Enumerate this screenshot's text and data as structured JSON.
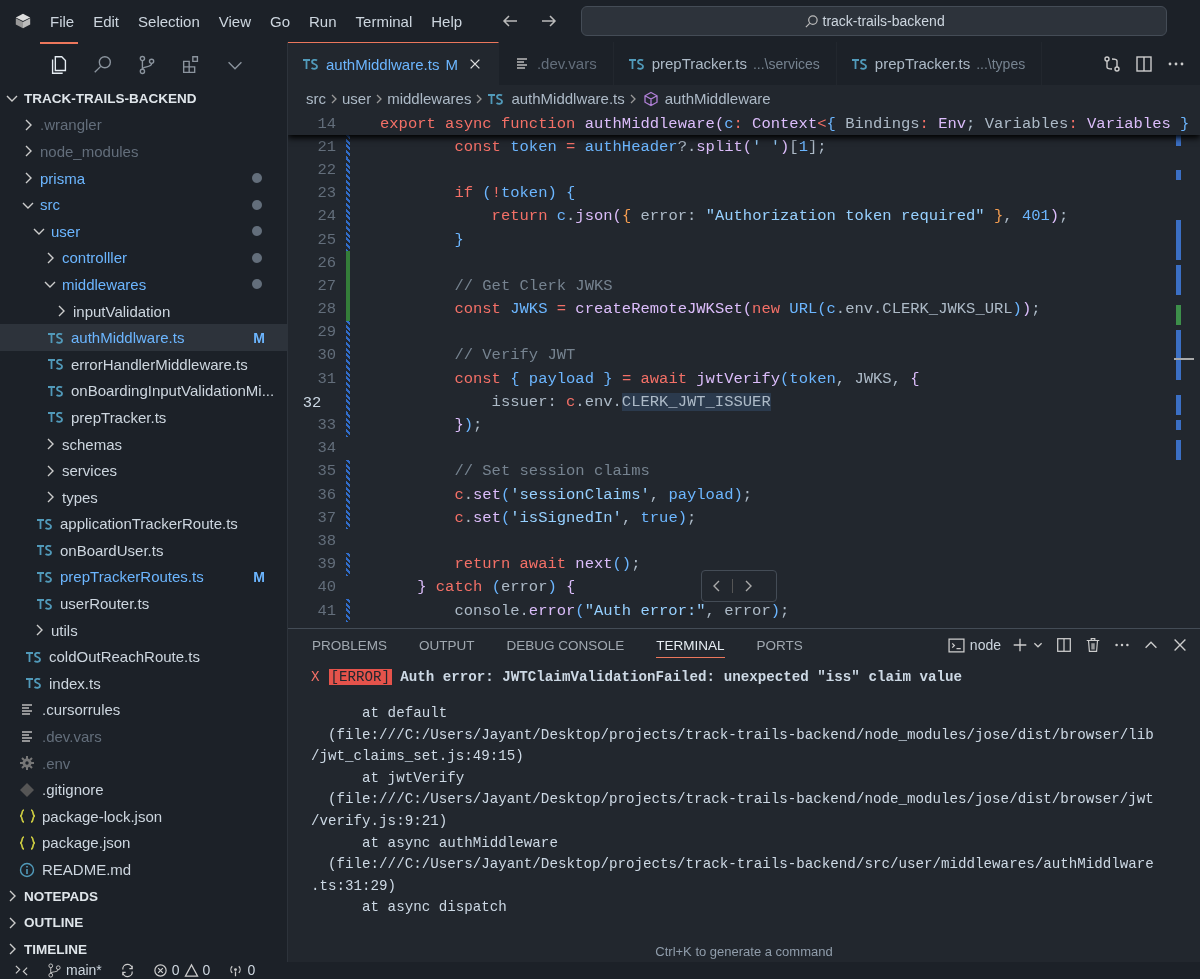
{
  "menu": [
    "File",
    "Edit",
    "Selection",
    "View",
    "Go",
    "Run",
    "Terminal",
    "Help"
  ],
  "command_center": {
    "value": "track-trails-backend"
  },
  "activity_bar": [
    {
      "kind": "files",
      "selected": true
    },
    {
      "kind": "search",
      "selected": false
    },
    {
      "kind": "source-control",
      "selected": false
    },
    {
      "kind": "extensions",
      "selected": false
    },
    {
      "kind": "more",
      "selected": false
    }
  ],
  "explorer": {
    "title": "TRACK-TRAILS-BACKEND",
    "expanded": true,
    "tree": [
      {
        "label": ".wrangler",
        "kind": "folder",
        "expanded": false,
        "modified": false,
        "ignored": true,
        "selected": false
      },
      {
        "label": "node_modules",
        "kind": "folder",
        "expanded": false,
        "modified": false,
        "ignored": true,
        "selected": false
      },
      {
        "label": "prisma",
        "kind": "folder",
        "expanded": false,
        "modified": true,
        "ignored": false,
        "selected": false
      },
      {
        "label": "src",
        "kind": "folder",
        "expanded": true,
        "modified": true,
        "ignored": false,
        "selected": false,
        "children": [
          {
            "label": "user",
            "kind": "folder",
            "expanded": true,
            "modified": true,
            "ignored": false,
            "selected": false,
            "children": [
              {
                "label": "controlller",
                "kind": "folder",
                "expanded": false,
                "modified": true,
                "ignored": false,
                "selected": false
              },
              {
                "label": "middlewares",
                "kind": "folder",
                "expanded": true,
                "modified": true,
                "ignored": false,
                "selected": false,
                "children": [
                  {
                    "label": "inputValidation",
                    "kind": "folder",
                    "expanded": false,
                    "modified": false,
                    "ignored": false,
                    "selected": false
                  },
                  {
                    "label": "authMiddlware.ts",
                    "kind": "ts",
                    "modified": true,
                    "ignored": false,
                    "badge": "M",
                    "selected": true
                  },
                  {
                    "label": "errorHandlerMiddleware.ts",
                    "kind": "ts",
                    "modified": false,
                    "ignored": false,
                    "selected": false
                  },
                  {
                    "label": "onBoardingInputValidationMi...",
                    "kind": "ts",
                    "modified": false,
                    "ignored": false,
                    "selected": false
                  },
                  {
                    "label": "prepTracker.ts",
                    "kind": "ts",
                    "modified": false,
                    "ignored": false,
                    "selected": false
                  }
                ]
              },
              {
                "label": "schemas",
                "kind": "folder",
                "expanded": false,
                "modified": false,
                "ignored": false,
                "selected": false
              },
              {
                "label": "services",
                "kind": "folder",
                "expanded": false,
                "modified": false,
                "ignored": false,
                "selected": false
              },
              {
                "label": "types",
                "kind": "folder",
                "expanded": false,
                "modified": false,
                "ignored": false,
                "selected": false
              },
              {
                "label": "applicationTrackerRoute.ts",
                "kind": "ts",
                "modified": false,
                "ignored": false,
                "selected": false
              },
              {
                "label": "onBoardUser.ts",
                "kind": "ts",
                "modified": false,
                "ignored": false,
                "selected": false
              },
              {
                "label": "prepTrackerRoutes.ts",
                "kind": "ts",
                "modified": true,
                "ignored": false,
                "badge": "M",
                "selected": false
              },
              {
                "label": "userRouter.ts",
                "kind": "ts",
                "modified": false,
                "ignored": false,
                "selected": false
              }
            ]
          },
          {
            "label": "utils",
            "kind": "folder",
            "expanded": false,
            "modified": false,
            "ignored": false,
            "selected": false
          },
          {
            "label": "coldOutReachRoute.ts",
            "kind": "ts",
            "modified": false,
            "ignored": false,
            "selected": false
          },
          {
            "label": "index.ts",
            "kind": "ts",
            "modified": false,
            "ignored": false,
            "selected": false
          }
        ]
      },
      {
        "label": ".cursorrules",
        "kind": "text",
        "modified": false,
        "ignored": false,
        "selected": false
      },
      {
        "label": ".dev.vars",
        "kind": "text",
        "modified": false,
        "ignored": true,
        "selected": false
      },
      {
        "label": ".env",
        "kind": "gear",
        "modified": false,
        "ignored": true,
        "selected": false
      },
      {
        "label": ".gitignore",
        "kind": "git",
        "modified": false,
        "ignored": false,
        "selected": false
      },
      {
        "label": "package-lock.json",
        "kind": "json",
        "modified": false,
        "ignored": false,
        "selected": false
      },
      {
        "label": "package.json",
        "kind": "json",
        "modified": false,
        "ignored": false,
        "selected": false
      },
      {
        "label": "README.md",
        "kind": "info",
        "modified": false,
        "ignored": false,
        "selected": false
      }
    ]
  },
  "sections": [
    {
      "title": "NOTEPADS",
      "expanded": false
    },
    {
      "title": "OUTLINE",
      "expanded": false
    },
    {
      "title": "TIMELINE",
      "expanded": false
    }
  ],
  "tabs": [
    {
      "kind": "ts",
      "label": "authMiddlware.ts",
      "badge": "M",
      "modified": true,
      "ignored": false,
      "selected": true
    },
    {
      "kind": "text",
      "label": ".dev.vars",
      "modified": false,
      "ignored": true,
      "selected": false
    },
    {
      "kind": "ts",
      "label": "prepTracker.ts",
      "description": "...\\services",
      "modified": false,
      "ignored": false,
      "selected": false
    },
    {
      "kind": "ts",
      "label": "prepTracker.ts",
      "description": "...\\types",
      "modified": false,
      "ignored": false,
      "selected": false
    }
  ],
  "breadcrumbs": [
    {
      "kind": "folder",
      "label": "src"
    },
    {
      "kind": "folder",
      "label": "user"
    },
    {
      "kind": "folder",
      "label": "middlewares"
    },
    {
      "kind": "ts",
      "label": "authMiddlware.ts"
    },
    {
      "kind": "symbol",
      "label": "authMiddleware"
    }
  ],
  "sticky_line": {
    "number": "14",
    "tokens": [
      {
        "kind": "keyword",
        "text": "export async function "
      },
      {
        "kind": "function",
        "text": "authMiddleware"
      },
      {
        "kind": "bracket",
        "text": "("
      },
      {
        "kind": "variable",
        "text": "c"
      },
      {
        "kind": "keyword",
        "text": ": "
      },
      {
        "kind": "function",
        "text": "Context"
      },
      {
        "kind": "keyword",
        "text": "<"
      },
      {
        "kind": "bracket2",
        "text": "{ "
      },
      {
        "kind": "plain",
        "text": "Bindings"
      },
      {
        "kind": "keyword",
        "text": ": "
      },
      {
        "kind": "function",
        "text": "Env"
      },
      {
        "kind": "plain",
        "text": "; Variables"
      },
      {
        "kind": "keyword",
        "text": ": "
      },
      {
        "kind": "function",
        "text": "Variables"
      },
      {
        "kind": "bracket2",
        "text": " }"
      }
    ]
  },
  "code_lines": [
    {
      "number": "21",
      "modified": true,
      "added": false,
      "active": false,
      "tokens": [
        {
          "kind": "keyword",
          "text": "        const "
        },
        {
          "kind": "variable",
          "text": "token"
        },
        {
          "kind": "keyword",
          "text": " = "
        },
        {
          "kind": "variable",
          "text": "authHeader"
        },
        {
          "kind": "plain",
          "text": "?."
        },
        {
          "kind": "function",
          "text": "split"
        },
        {
          "kind": "bracket",
          "text": "("
        },
        {
          "kind": "string",
          "text": "' '"
        },
        {
          "kind": "bracket",
          "text": ")"
        },
        {
          "kind": "plain",
          "text": "["
        },
        {
          "kind": "number",
          "text": "1"
        },
        {
          "kind": "plain",
          "text": "];"
        }
      ]
    },
    {
      "number": "22",
      "modified": true,
      "added": false,
      "active": false
    },
    {
      "number": "23",
      "modified": true,
      "added": false,
      "active": false,
      "tokens": [
        {
          "kind": "keyword",
          "text": "        if "
        },
        {
          "kind": "bracket2",
          "text": "("
        },
        {
          "kind": "keyword",
          "text": "!"
        },
        {
          "kind": "variable",
          "text": "token"
        },
        {
          "kind": "bracket2",
          "text": ") {"
        }
      ]
    },
    {
      "number": "24",
      "modified": true,
      "added": false,
      "active": false,
      "tokens": [
        {
          "kind": "keyword",
          "text": "            return "
        },
        {
          "kind": "variable",
          "text": "c"
        },
        {
          "kind": "plain",
          "text": "."
        },
        {
          "kind": "function",
          "text": "json"
        },
        {
          "kind": "bracket",
          "text": "("
        },
        {
          "kind": "bracket3",
          "text": "{ "
        },
        {
          "kind": "plain",
          "text": "error: "
        },
        {
          "kind": "string",
          "text": "\"Authorization token required\""
        },
        {
          "kind": "bracket3",
          "text": " }"
        },
        {
          "kind": "plain",
          "text": ", "
        },
        {
          "kind": "number",
          "text": "401"
        },
        {
          "kind": "bracket",
          "text": ")"
        },
        {
          "kind": "plain",
          "text": ";"
        }
      ]
    },
    {
      "number": "25",
      "modified": true,
      "added": false,
      "active": false,
      "tokens": [
        {
          "kind": "bracket2",
          "text": "        }"
        }
      ]
    },
    {
      "number": "26",
      "modified": false,
      "added": true,
      "active": false
    },
    {
      "number": "27",
      "modified": false,
      "added": true,
      "active": false,
      "tokens": [
        {
          "kind": "comment",
          "text": "        // Get Clerk JWKS"
        }
      ]
    },
    {
      "number": "28",
      "modified": false,
      "added": true,
      "active": false,
      "tokens": [
        {
          "kind": "keyword",
          "text": "        const "
        },
        {
          "kind": "variable",
          "text": "JWKS"
        },
        {
          "kind": "keyword",
          "text": " = "
        },
        {
          "kind": "function",
          "text": "createRemoteJWKSet"
        },
        {
          "kind": "bracket",
          "text": "("
        },
        {
          "kind": "keyword",
          "text": "new "
        },
        {
          "kind": "variable",
          "text": "URL"
        },
        {
          "kind": "bracket2",
          "text": "("
        },
        {
          "kind": "variable",
          "text": "c"
        },
        {
          "kind": "plain",
          "text": ".env.CLERK_JWKS_URL"
        },
        {
          "kind": "bracket2",
          "text": ")"
        },
        {
          "kind": "bracket",
          "text": ")"
        },
        {
          "kind": "plain",
          "text": ";"
        }
      ]
    },
    {
      "number": "29",
      "modified": true,
      "added": false,
      "active": false
    },
    {
      "number": "30",
      "modified": true,
      "added": false,
      "active": false,
      "tokens": [
        {
          "kind": "comment",
          "text": "        // Verify JWT"
        }
      ]
    },
    {
      "number": "31",
      "modified": true,
      "added": false,
      "active": false,
      "tokens": [
        {
          "kind": "keyword",
          "text": "        const "
        },
        {
          "kind": "bracket2",
          "text": "{ "
        },
        {
          "kind": "variable",
          "text": "payload"
        },
        {
          "kind": "bracket2",
          "text": " }"
        },
        {
          "kind": "keyword",
          "text": " = await "
        },
        {
          "kind": "function",
          "text": "jwtVerify"
        },
        {
          "kind": "bracket2",
          "text": "("
        },
        {
          "kind": "variable",
          "text": "token"
        },
        {
          "kind": "plain",
          "text": ", JWKS, "
        },
        {
          "kind": "bracket",
          "text": "{"
        }
      ]
    },
    {
      "number": "32",
      "modified": true,
      "added": false,
      "active": true,
      "tokens": [
        {
          "kind": "plain",
          "text": "            issuer: "
        },
        {
          "kind": "keyword",
          "text": "c"
        },
        {
          "kind": "plain",
          "text": ".env."
        },
        {
          "kind": "highlight",
          "text": "CLERK_JWT_ISSUER"
        }
      ]
    },
    {
      "number": "33",
      "modified": true,
      "added": false,
      "active": false,
      "tokens": [
        {
          "kind": "bracket",
          "text": "        }"
        },
        {
          "kind": "bracket2",
          "text": ")"
        },
        {
          "kind": "plain",
          "text": ";"
        }
      ]
    },
    {
      "number": "34",
      "modified": false,
      "added": false,
      "active": false
    },
    {
      "number": "35",
      "modified": true,
      "added": false,
      "active": false,
      "tokens": [
        {
          "kind": "comment",
          "text": "        // Set session claims"
        }
      ]
    },
    {
      "number": "36",
      "modified": true,
      "added": false,
      "active": false,
      "tokens": [
        {
          "kind": "keyword",
          "text": "        c"
        },
        {
          "kind": "plain",
          "text": "."
        },
        {
          "kind": "function",
          "text": "set"
        },
        {
          "kind": "bracket2",
          "text": "("
        },
        {
          "kind": "string",
          "text": "'sessionClaims'"
        },
        {
          "kind": "plain",
          "text": ", "
        },
        {
          "kind": "variable",
          "text": "payload"
        },
        {
          "kind": "bracket2",
          "text": ")"
        },
        {
          "kind": "plain",
          "text": ";"
        }
      ]
    },
    {
      "number": "37",
      "modified": true,
      "added": false,
      "active": false,
      "tokens": [
        {
          "kind": "keyword",
          "text": "        c"
        },
        {
          "kind": "plain",
          "text": "."
        },
        {
          "kind": "function",
          "text": "set"
        },
        {
          "kind": "bracket2",
          "text": "("
        },
        {
          "kind": "string",
          "text": "'isSignedIn'"
        },
        {
          "kind": "plain",
          "text": ", "
        },
        {
          "kind": "variable",
          "text": "true"
        },
        {
          "kind": "bracket2",
          "text": ")"
        },
        {
          "kind": "plain",
          "text": ";"
        }
      ]
    },
    {
      "number": "38",
      "modified": false,
      "added": false,
      "active": false
    },
    {
      "number": "39",
      "modified": true,
      "added": false,
      "active": false,
      "tokens": [
        {
          "kind": "keyword",
          "text": "        return await "
        },
        {
          "kind": "function",
          "text": "next"
        },
        {
          "kind": "bracket2",
          "text": "()"
        },
        {
          "kind": "plain",
          "text": ";"
        }
      ]
    },
    {
      "number": "40",
      "modified": false,
      "added": false,
      "active": false,
      "tokens": [
        {
          "kind": "bracket",
          "text": "    }"
        },
        {
          "kind": "keyword",
          "text": " catch "
        },
        {
          "kind": "bracket2",
          "text": "("
        },
        {
          "kind": "plain",
          "text": "error"
        },
        {
          "kind": "bracket2",
          "text": ") "
        },
        {
          "kind": "bracket",
          "text": "{"
        }
      ]
    },
    {
      "number": "41",
      "modified": true,
      "added": false,
      "active": false,
      "tokens": [
        {
          "kind": "plain",
          "text": "        console."
        },
        {
          "kind": "function",
          "text": "error"
        },
        {
          "kind": "bracket2",
          "text": "("
        },
        {
          "kind": "string",
          "text": "\"Auth error:\""
        },
        {
          "kind": "plain",
          "text": ", error"
        },
        {
          "kind": "bracket2",
          "text": ")"
        },
        {
          "kind": "plain",
          "text": ";"
        }
      ]
    }
  ],
  "panel": {
    "tabs": [
      {
        "label": "PROBLEMS",
        "selected": false
      },
      {
        "label": "OUTPUT",
        "selected": false
      },
      {
        "label": "DEBUG CONSOLE",
        "selected": false
      },
      {
        "label": "TERMINAL",
        "selected": true
      },
      {
        "label": "PORTS",
        "selected": false
      }
    ],
    "terminal_name": "node",
    "error": {
      "mark": "X",
      "tag": "[ERROR]",
      "message": "Auth error: JWTClaimValidationFailed: unexpected \"iss\" claim value"
    },
    "trace": [
      "      at default",
      "  (file:///C:/Users/Jayant/Desktop/projects/track-trails-backend/node_modules/jose/dist/browser/lib",
      "/jwt_claims_set.js:49:15)",
      "      at jwtVerify",
      "  (file:///C:/Users/Jayant/Desktop/projects/track-trails-backend/node_modules/jose/dist/browser/jwt",
      "/verify.js:9:21)",
      "      at async authMiddleware",
      "  (file:///C:/Users/Jayant/Desktop/projects/track-trails-backend/src/user/middlewares/authMiddlware",
      ".ts:31:29)",
      "      at async dispatch"
    ],
    "hint": "Ctrl+K to generate a command"
  },
  "status_bar": {
    "branch": "main*",
    "errors": "0",
    "warnings": "0",
    "ports": "0"
  }
}
